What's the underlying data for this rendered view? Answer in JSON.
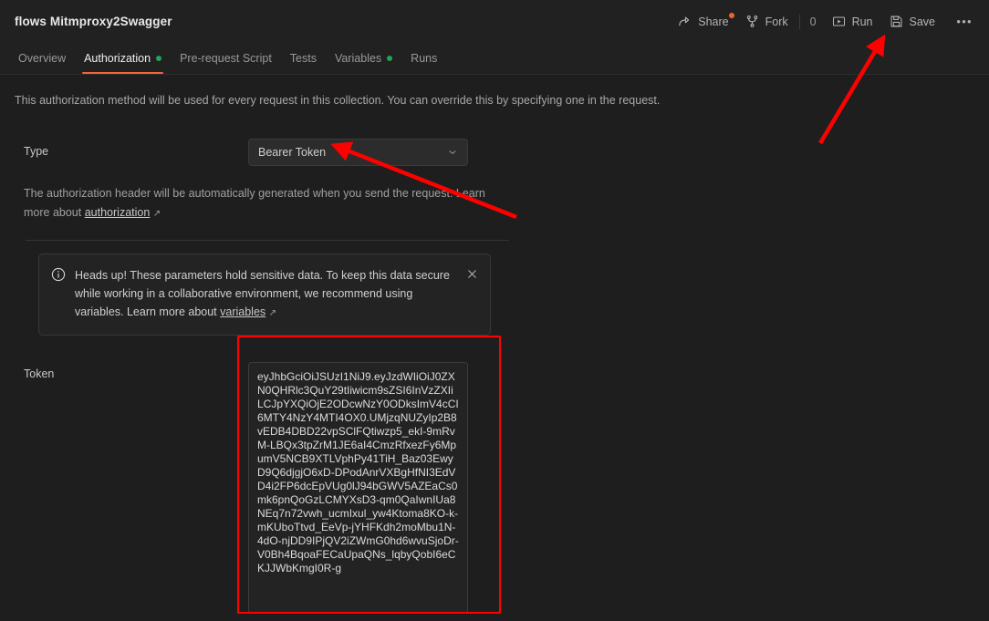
{
  "header": {
    "collection_title": "flows Mitmproxy2Swagger",
    "actions": [
      {
        "name": "share",
        "label": "Share",
        "icon": "share-arrow-icon",
        "has_badge": true
      },
      {
        "name": "fork",
        "label": "Fork",
        "icon": "fork-icon",
        "has_badge": false
      },
      {
        "name": "run",
        "label": "Run",
        "icon": "play-icon",
        "has_badge": false
      },
      {
        "name": "save",
        "label": "Save",
        "icon": "floppy-disk-icon",
        "has_badge": false
      }
    ],
    "fork_count": "0",
    "more_label": "●●●"
  },
  "tabs": [
    {
      "label": "Overview",
      "active": false,
      "dot": false
    },
    {
      "label": "Authorization",
      "active": true,
      "dot": true
    },
    {
      "label": "Pre-request Script",
      "active": false,
      "dot": false
    },
    {
      "label": "Tests",
      "active": false,
      "dot": false
    },
    {
      "label": "Variables",
      "active": false,
      "dot": true
    },
    {
      "label": "Runs",
      "active": false,
      "dot": false
    }
  ],
  "main": {
    "intro": "This authorization method will be used for every request in this collection. You can override this by specifying one in the request.",
    "type_label": "Type",
    "type_value": "Bearer Token",
    "helper_prefix": "The authorization header will be automatically generated when you send the request. Learn more about ",
    "helper_link": "authorization",
    "ext_arrow": "↗",
    "banner": {
      "text_prefix": "Heads up! These parameters hold sensitive data. To keep this data secure while working in a collaborative environment, we recommend using variables. Learn more about ",
      "link": "variables",
      "ext_arrow": "↗",
      "close_label": "✕"
    },
    "token_label": "Token",
    "token_value": "eyJhbGciOiJSUzI1NiJ9.eyJzdWIiOiJ0ZXN0QHRlc3QuY29tIiwicm9sZSI6InVzZXIiLCJpYXQiOjE2ODcwNzY0ODksImV4cCI6MTY4NzY4MTI4OX0.UMjzqNUZyIp2B8vEDB4DBD22vpSClFQtiwzp5_ekI-9mRvM-LBQx3tpZrM1JE6aI4CmzRfxezFy6MpumV5NCB9XTLVphPy41TiH_Baz03EwyD9Q6djgjO6xD-DPodAnrVXBgHfNI3EdVD4i2FP6dcEpVUg0lJ94bGWV5AZEaCs0mk6pnQoGzLCMYXsD3-qm0QaIwnIUa8NEq7n72vwh_ucmIxul_yw4Ktoma8KO-k-mKUboTtvd_EeVp-jYHFKdh2moMbu1N-4dO-njDD9IPjQV2iZWmG0hd6wvuSjoDr-V0Bh4BqoaFECaUpaQNs_lqbyQobI6eCKJJWbKmgI0R-g"
  },
  "annotations": {
    "arrow_1": {
      "name": "arrow-to-type-dropdown",
      "color": "#ff0000"
    },
    "arrow_2": {
      "name": "arrow-to-save-button",
      "color": "#ff0000"
    },
    "highlight_box": {
      "name": "token-field-highlight",
      "color": "#ff0000"
    }
  }
}
